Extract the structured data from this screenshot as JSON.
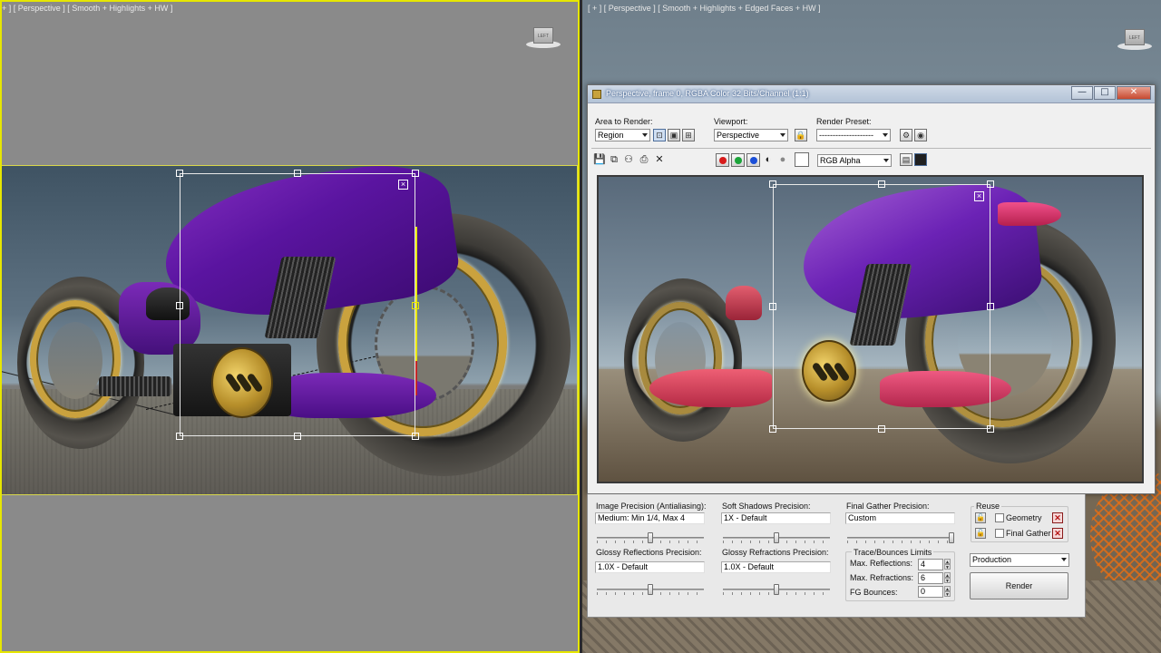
{
  "left_viewport": {
    "label": "+ ] [ Perspective ] [ Smooth + Highlights + HW ]",
    "viewcube_label": "LEFT"
  },
  "right_viewport": {
    "label": "[ + ] [ Perspective ] [ Smooth + Highlights + Edged Faces + HW ]",
    "viewcube_label": "LEFT"
  },
  "render_window": {
    "title": "Perspective, frame 0, RGBA Color 32 Bits/Channel (1:1)",
    "window_buttons": {
      "minimize": "—",
      "maximize": "□",
      "close": "✕"
    },
    "area_to_render": {
      "label": "Area to Render:",
      "value": "Region"
    },
    "viewport": {
      "label": "Viewport:",
      "value": "Perspective"
    },
    "render_preset": {
      "label": "Render Preset:",
      "value": "--------------------"
    },
    "channel_display": {
      "value": "RGB Alpha"
    },
    "toolbar_icons": [
      "save-icon",
      "copy-icon",
      "clone-icon",
      "print-icon",
      "clear-icon"
    ],
    "channel_colors": {
      "red": "#d81b1b",
      "green": "#1ba43a",
      "blue": "#1b4fd8"
    }
  },
  "render_settings": {
    "image_precision": {
      "label": "Image Precision (Antialiasing):",
      "value": "Medium: Min 1/4, Max 4",
      "level": 0.5
    },
    "soft_shadows": {
      "label": "Soft Shadows Precision:",
      "value": "1X - Default",
      "level": 0.5
    },
    "final_gather": {
      "label": "Final Gather Precision:",
      "value": "Custom",
      "level": 1.0
    },
    "glossy_reflections": {
      "label": "Glossy Reflections Precision:",
      "value": "1.0X - Default",
      "level": 0.5
    },
    "glossy_refractions": {
      "label": "Glossy Refractions Precision:",
      "value": "1.0X - Default",
      "level": 0.5
    },
    "trace_bounces": {
      "label": "Trace/Bounces Limits",
      "max_reflections": {
        "label": "Max. Reflections:",
        "value": "4"
      },
      "max_refractions": {
        "label": "Max. Refractions:",
        "value": "6"
      },
      "fg_bounces": {
        "label": "FG Bounces:",
        "value": "0"
      }
    },
    "reuse": {
      "label": "Reuse",
      "geometry": {
        "label": "Geometry",
        "checked": false
      },
      "final_gather": {
        "label": "Final Gather",
        "checked": false
      }
    },
    "mode": {
      "value": "Production"
    },
    "render_button": "Render"
  }
}
